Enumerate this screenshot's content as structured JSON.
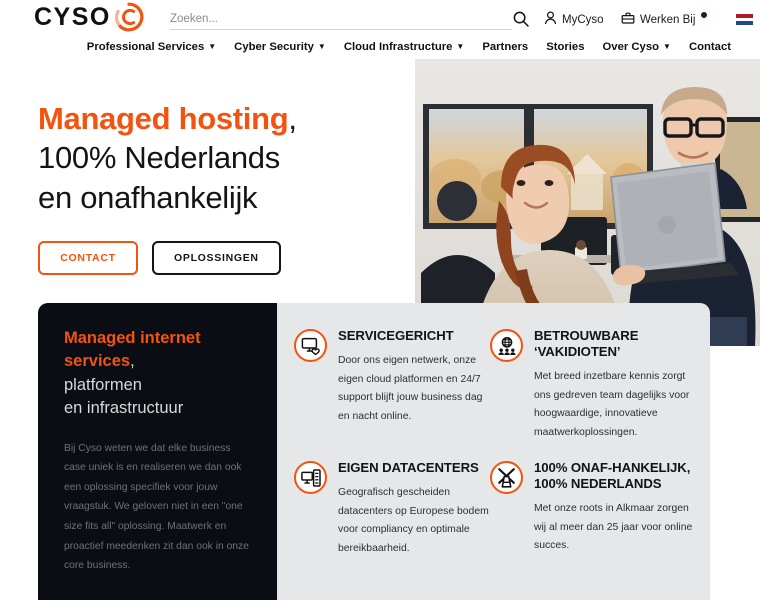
{
  "brand": {
    "name": "CYSO",
    "logo_mark": "cyso-c-icon",
    "accent": "#f4520f",
    "dark": "#0b0d14",
    "panel_gray": "#e6e7e8"
  },
  "header": {
    "search": {
      "placeholder": "Zoeken...",
      "value": "",
      "icon": "search-icon"
    },
    "utilities": [
      {
        "label": "MyCyso",
        "icon": "user-icon",
        "badge": false
      },
      {
        "label": "Werken Bij",
        "icon": "briefcase-icon",
        "badge": true
      }
    ],
    "language": {
      "name": "nl",
      "icon": "flag-nl-icon"
    }
  },
  "nav": {
    "items": [
      {
        "label": "Professional Services",
        "has_dropdown": true
      },
      {
        "label": "Cyber Security",
        "has_dropdown": true
      },
      {
        "label": "Cloud Infrastructure",
        "has_dropdown": true
      },
      {
        "label": "Partners",
        "has_dropdown": false
      },
      {
        "label": "Stories",
        "has_dropdown": false
      },
      {
        "label": "Over Cyso",
        "has_dropdown": true
      },
      {
        "label": "Contact",
        "has_dropdown": false
      }
    ],
    "chevron": "⌄"
  },
  "hero": {
    "heading_highlight": "Managed hosting",
    "heading_comma": ",",
    "heading_line2": "100% Nederlands",
    "heading_line3": "en onafhankelijk",
    "buttons": [
      {
        "label": "CONTACT",
        "style": "outline-orange"
      },
      {
        "label": "OPLOSSINGEN",
        "style": "outline-dark"
      }
    ],
    "photo_alt": "two-colleagues-office-photo"
  },
  "intro_card": {
    "heading_highlight": "Managed internet services",
    "heading_comma": ",",
    "heading_line2": "platformen",
    "heading_line3": "en infrastructuur",
    "paragraph": "Bij Cyso weten we dat elke business case uniek is en realiseren we dan ook een oplossing specifiek voor jouw vraagstuk. We geloven niet in een \"one size fits all\" oplossing. Maatwerk en proactief meedenken zit dan ook in onze core business."
  },
  "features": [
    {
      "icon": "monitor-heart-icon",
      "title": "SERVICEGERICHT",
      "text": "Door ons eigen netwerk, onze eigen cloud platformen en 24/7 support blijft jouw business dag en nacht online."
    },
    {
      "icon": "globe-people-icon",
      "title": "BETROUWBARE ‘VAKIDIOTEN’",
      "text": "Met breed inzetbare kennis zorgt ons gedreven team dagelijks voor hoogwaardige, innovatieve maatwerkoplossingen."
    },
    {
      "icon": "server-desktop-icon",
      "title": "EIGEN DATACENTERS",
      "text": "Geografisch gescheiden datacenters op Europese bodem voor compliancy en optimale bereikbaarheid."
    },
    {
      "icon": "windmill-icon",
      "title": "100% ONAF-HANKELIJK, 100% NEDERLANDS",
      "text": "Met onze roots in Alkmaar zorgen wij al meer dan 25 jaar voor online succes."
    }
  ]
}
